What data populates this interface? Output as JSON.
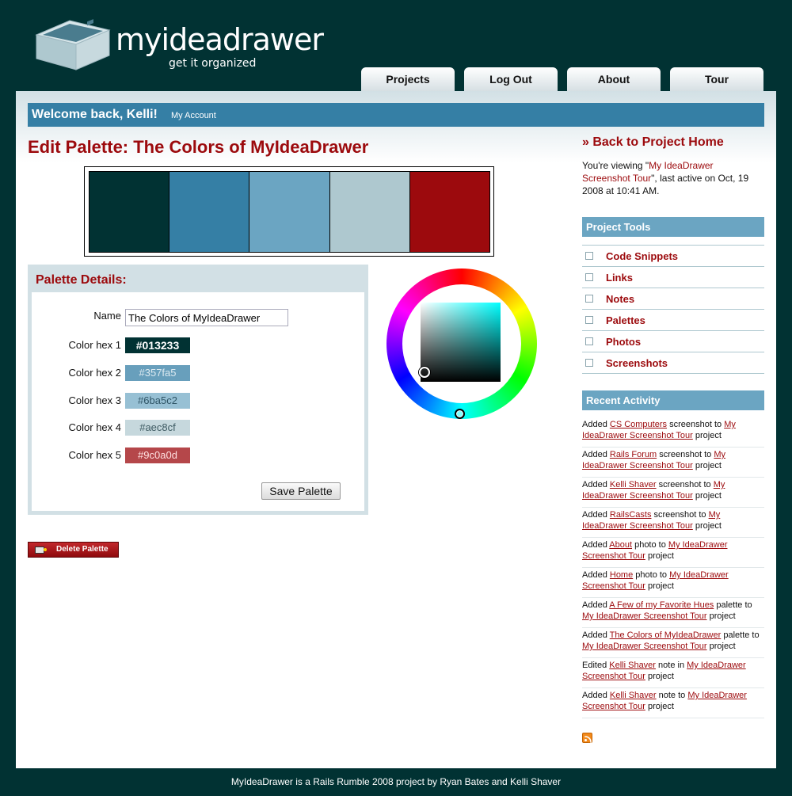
{
  "header": {
    "logo_text": "myideadrawer",
    "tagline": "get it organized",
    "tabs": [
      "Projects",
      "Log Out",
      "About",
      "Tour"
    ]
  },
  "welcome": {
    "greeting": "Welcome back, Kelli!",
    "account_link": "My Account"
  },
  "main": {
    "title": "Edit Palette: The Colors of MyIdeaDrawer",
    "palette_colors": [
      "#013233",
      "#357fa5",
      "#6ba5c2",
      "#aec8cf",
      "#9c0a0d"
    ],
    "details": {
      "title": "Palette Details:",
      "name_label": "Name",
      "name_value": "The Colors of MyIdeaDrawer",
      "colors": [
        {
          "label": "Color hex 1",
          "value": "#013233"
        },
        {
          "label": "Color hex 2",
          "value": "#357fa5"
        },
        {
          "label": "Color hex 3",
          "value": "#6ba5c2"
        },
        {
          "label": "Color hex 4",
          "value": "#aec8cf"
        },
        {
          "label": "Color hex 5",
          "value": "#9c0a0d"
        }
      ],
      "save_label": "Save Palette"
    },
    "delete_label": "Delete Palette"
  },
  "sidebar": {
    "back_link": "» Back to Project Home",
    "viewing": {
      "prefix": "You're viewing \"",
      "project": "My IdeaDrawer Screenshot Tour",
      "suffix": "\", last active on Oct, 19 2008 at 10:41 AM."
    },
    "tools_heading": "Project Tools",
    "tools": [
      "Code Snippets",
      "Links",
      "Notes",
      "Palettes",
      "Photos",
      "Screenshots"
    ],
    "activity_heading": "Recent Activity",
    "activity": [
      {
        "verb": "Added",
        "item": "CS Computers",
        "mid": "screenshot to",
        "project": "My IdeaDrawer Screenshot Tour",
        "end": "project"
      },
      {
        "verb": "Added",
        "item": "Rails Forum",
        "mid": "screenshot to",
        "project": "My IdeaDrawer Screenshot Tour",
        "end": "project"
      },
      {
        "verb": "Added",
        "item": "Kelli Shaver",
        "mid": "screenshot to",
        "project": "My IdeaDrawer Screenshot Tour",
        "end": "project"
      },
      {
        "verb": "Added",
        "item": "RailsCasts",
        "mid": "screenshot to",
        "project": "My IdeaDrawer Screenshot Tour",
        "end": "project"
      },
      {
        "verb": "Added",
        "item": "About",
        "mid": "photo to",
        "project": "My IdeaDrawer Screenshot Tour",
        "end": "project"
      },
      {
        "verb": "Added",
        "item": "Home",
        "mid": "photo to",
        "project": "My IdeaDrawer Screenshot Tour",
        "end": "project"
      },
      {
        "verb": "Added",
        "item": "A Few of my Favorite Hues",
        "mid": "palette to",
        "project": "My IdeaDrawer Screenshot Tour",
        "end": "project"
      },
      {
        "verb": "Added",
        "item": "The Colors of MyIdeaDrawer",
        "mid": "palette to",
        "project": "My IdeaDrawer Screenshot Tour",
        "end": "project"
      },
      {
        "verb": "Edited",
        "item": "Kelli Shaver",
        "mid": "note in",
        "project": "My IdeaDrawer Screenshot Tour",
        "end": "project"
      },
      {
        "verb": "Added",
        "item": "Kelli Shaver",
        "mid": "note to",
        "project": "My IdeaDrawer Screenshot Tour",
        "end": "project"
      }
    ]
  },
  "footer": "MyIdeaDrawer is a Rails Rumble 2008 project by Ryan Bates and Kelli Shaver",
  "icons": [
    "logo-drawer-icon",
    "checkbox-icon",
    "rss-icon",
    "delete-palette-icon"
  ]
}
